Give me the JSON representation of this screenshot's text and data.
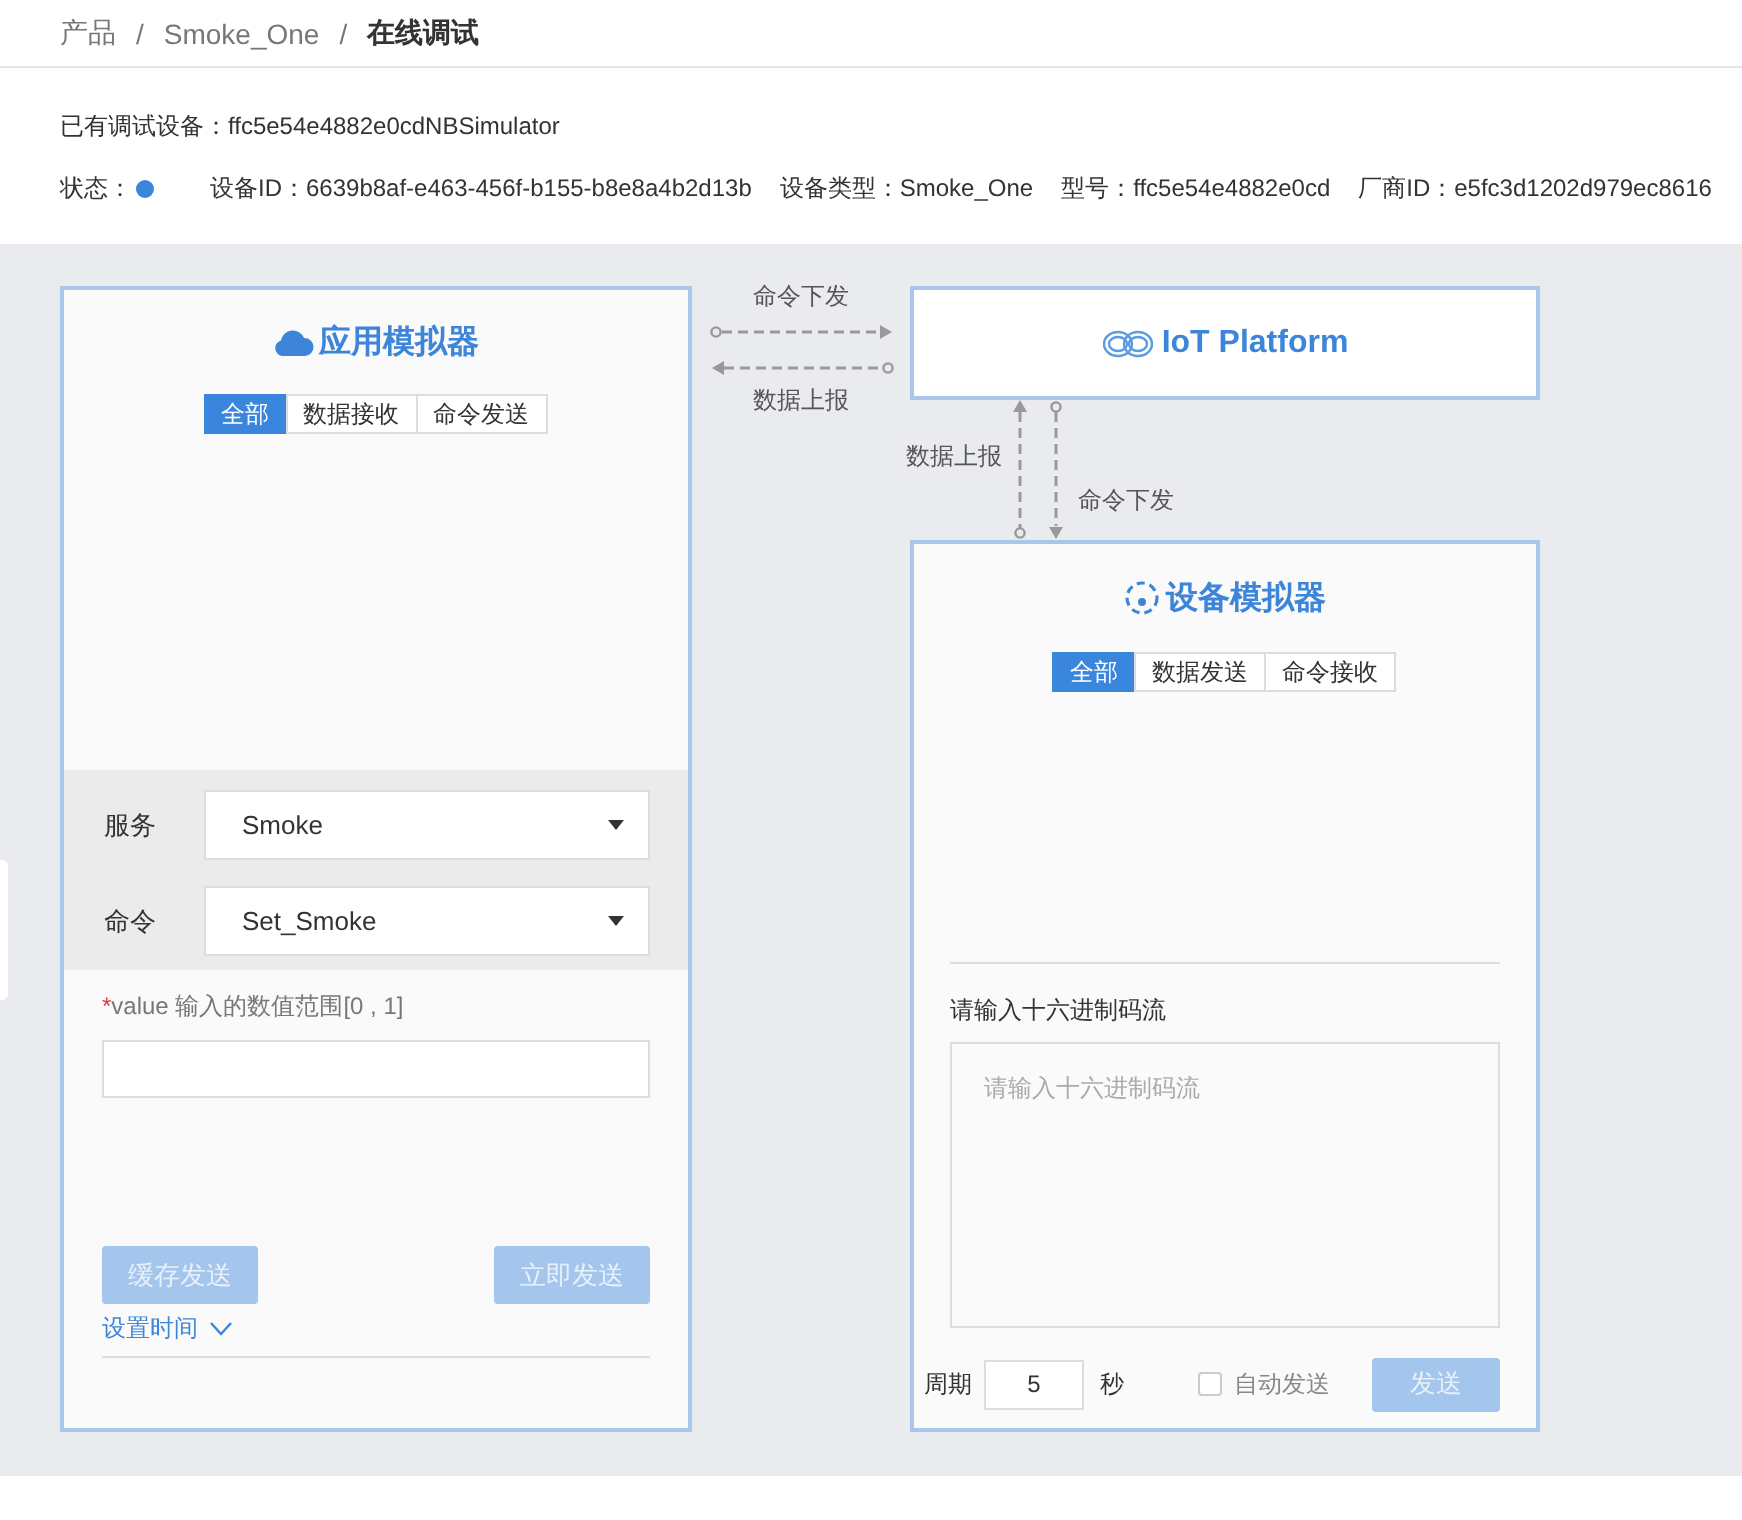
{
  "breadcrumb": {
    "items": [
      "产品",
      "Smoke_One",
      "在线调试"
    ],
    "separators": [
      "/",
      "/"
    ]
  },
  "info": {
    "debug_device": {
      "label": "已有调试设备：",
      "value": "ffc5e54e4882e0cdNBSimulator"
    },
    "fields": [
      {
        "kind": "status",
        "label": "状态：",
        "online": true
      },
      {
        "kind": "text",
        "label": "设备ID：",
        "value": "6639b8af-e463-456f-b155-b8e8a4b2d13b"
      },
      {
        "kind": "text",
        "label": "设备类型：",
        "value": "Smoke_One"
      },
      {
        "kind": "text",
        "label": "型号：",
        "value": "ffc5e54e4882e0cd"
      },
      {
        "kind": "text",
        "label": "厂商ID：",
        "value": "e5fc3d1202d979ec8616"
      }
    ]
  },
  "app_simulator": {
    "title": "应用模拟器",
    "tabs": [
      {
        "label": "全部",
        "selected": true
      },
      {
        "label": "数据接收",
        "selected": false
      },
      {
        "label": "命令发送",
        "selected": false
      }
    ],
    "selects": [
      {
        "label": "服务",
        "value": "Smoke"
      },
      {
        "label": "命令",
        "value": "Set_Smoke"
      }
    ],
    "param": {
      "required_mark": "*",
      "label": "value 输入的数值范围[0 , 1]"
    },
    "buttons": [
      {
        "label": "缓存发送",
        "disabled": true
      },
      {
        "label": "立即发送",
        "disabled": true
      }
    ],
    "set_time": "设置时间"
  },
  "flow": {
    "to_platform": "命令下发",
    "from_platform": "数据上报",
    "up": "数据上报",
    "down": "命令下发"
  },
  "platform": {
    "title": "IoT Platform"
  },
  "device_simulator": {
    "title": "设备模拟器",
    "tabs": [
      {
        "label": "全部",
        "selected": true
      },
      {
        "label": "数据发送",
        "selected": false
      },
      {
        "label": "命令接收",
        "selected": false
      }
    ],
    "hex_input": {
      "label": "请输入十六进制码流",
      "placeholder": "请输入十六进制码流"
    },
    "period": {
      "label": "周期",
      "value": "5",
      "unit": "秒"
    },
    "auto_send": {
      "label": "自动发送",
      "checked": false
    },
    "send_button": {
      "label": "发送",
      "disabled": true
    }
  }
}
